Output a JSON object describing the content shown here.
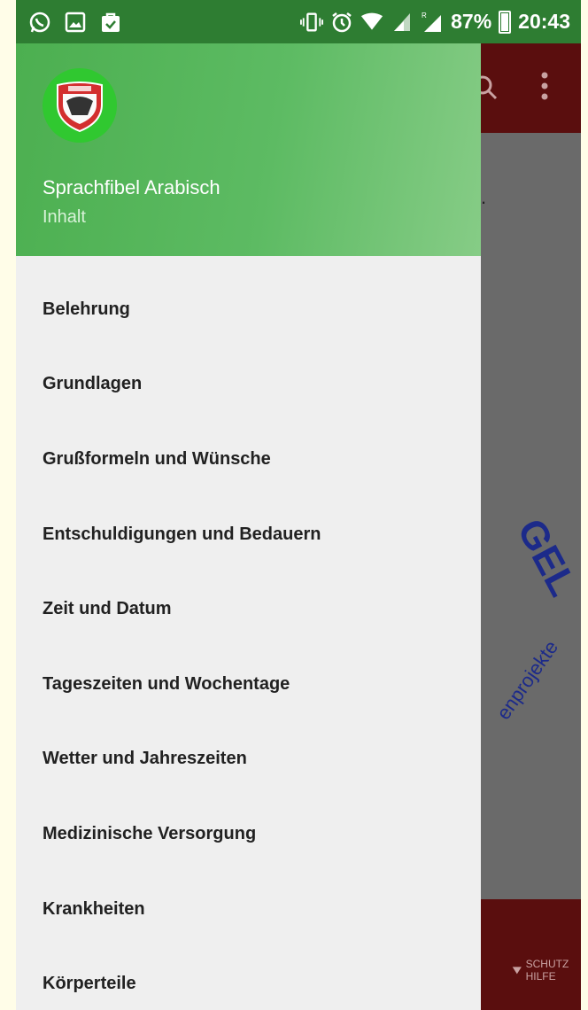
{
  "status_bar": {
    "battery": "87%",
    "time": "20:43",
    "icons": [
      "whatsapp-icon",
      "gallery-icon",
      "shopping-bag-icon",
      "vibrate-icon",
      "alarm-icon",
      "wifi-icon",
      "signal-icon",
      "roaming-signal-icon"
    ]
  },
  "drawer": {
    "header": {
      "app_name": "Sprachfibel Arabisch",
      "subtitle": "Inhalt"
    },
    "items": [
      {
        "label": "Belehrung"
      },
      {
        "label": "Grundlagen"
      },
      {
        "label": "Grußformeln und Wünsche"
      },
      {
        "label": "Entschuldigungen und Bedauern"
      },
      {
        "label": "Zeit und Datum"
      },
      {
        "label": "Tageszeiten und Wochentage"
      },
      {
        "label": "Wetter und Jahreszeiten"
      },
      {
        "label": "Medizinische Versorgung"
      },
      {
        "label": "Krankheiten"
      },
      {
        "label": "Körperteile"
      }
    ]
  },
  "background_app": {
    "watermark": "GEL",
    "watermark_sub": "enprojekte",
    "footer_badge": "SCHUTZ HILFE"
  },
  "colors": {
    "status_bar": "#2e7d32",
    "header_start": "#4caf50",
    "header_end": "#86cc86",
    "drawer_bg": "#efefef",
    "app_toolbar": "#5a0e0e",
    "scrim": "#6a6a6a",
    "watermark": "#1c2a8a"
  }
}
